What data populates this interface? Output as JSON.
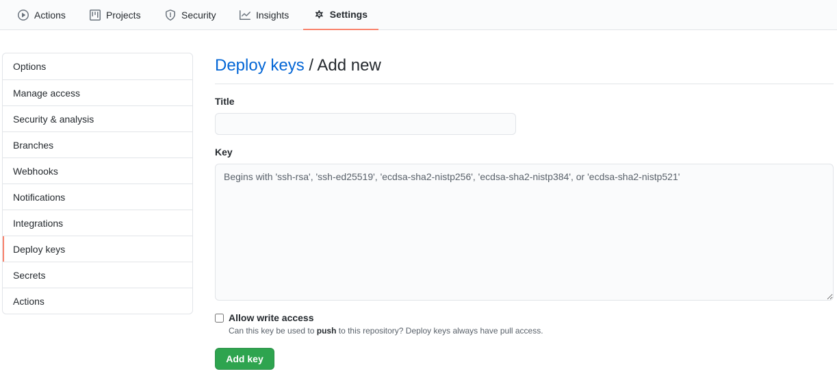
{
  "tabs": [
    {
      "label": "Actions",
      "icon": "play-icon"
    },
    {
      "label": "Projects",
      "icon": "project-icon"
    },
    {
      "label": "Security",
      "icon": "shield-icon"
    },
    {
      "label": "Insights",
      "icon": "graph-icon"
    },
    {
      "label": "Settings",
      "icon": "gear-icon",
      "selected": true
    }
  ],
  "sidebar": {
    "items": [
      {
        "label": "Options"
      },
      {
        "label": "Manage access"
      },
      {
        "label": "Security & analysis"
      },
      {
        "label": "Branches"
      },
      {
        "label": "Webhooks"
      },
      {
        "label": "Notifications"
      },
      {
        "label": "Integrations"
      },
      {
        "label": "Deploy keys",
        "selected": true
      },
      {
        "label": "Secrets"
      },
      {
        "label": "Actions"
      }
    ]
  },
  "main": {
    "breadcrumb_link": "Deploy keys",
    "breadcrumb_rest": " / Add new",
    "title_label": "Title",
    "title_value": "",
    "key_label": "Key",
    "key_placeholder": "Begins with 'ssh-rsa', 'ssh-ed25519', 'ecdsa-sha2-nistp256', 'ecdsa-sha2-nistp384', or 'ecdsa-sha2-nistp521'",
    "write_access_label": "Allow write access",
    "write_access_checked": false,
    "note_before": "Can this key be used to ",
    "note_bold": "push",
    "note_after": " to this repository? Deploy keys always have pull access.",
    "add_button": "Add key"
  },
  "colors": {
    "accent": "#f9826c",
    "link": "#0366d6",
    "primary_button": "#2ea44f"
  }
}
